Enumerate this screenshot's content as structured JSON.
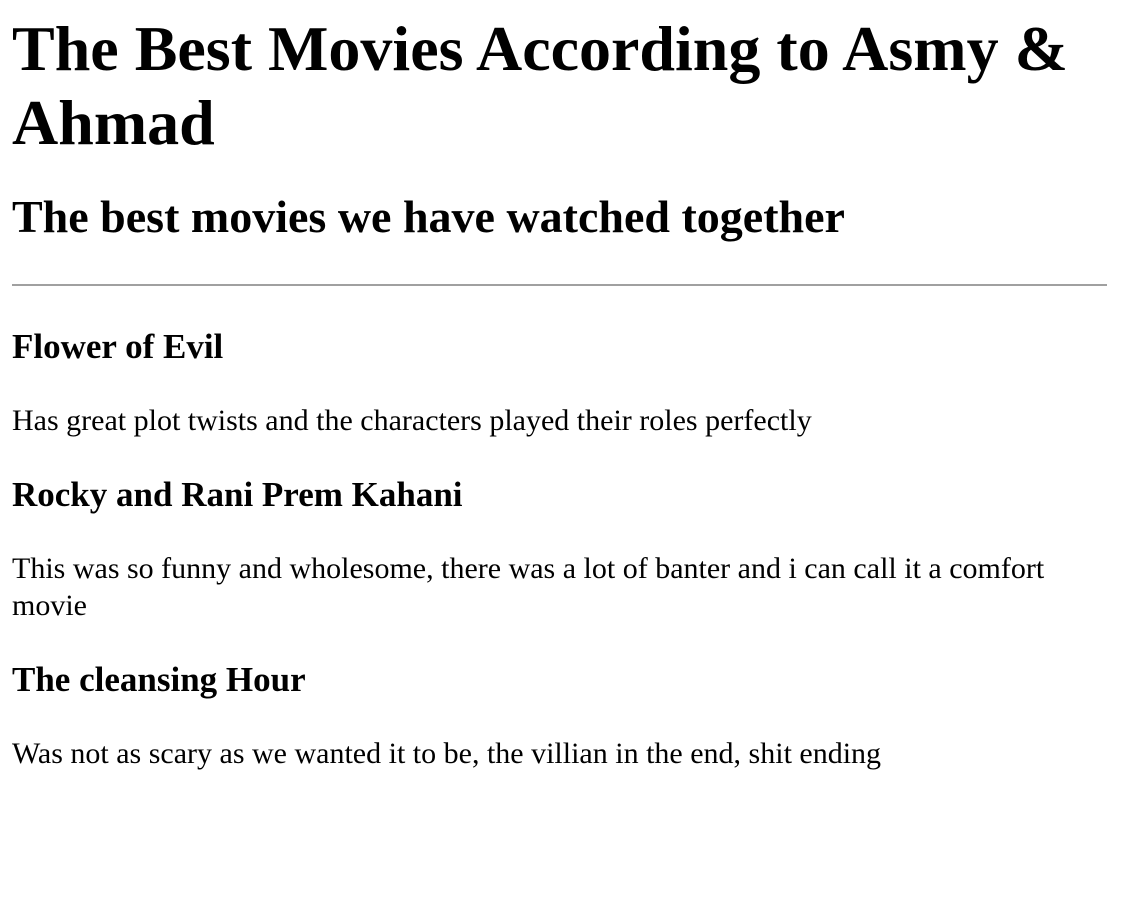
{
  "page": {
    "title": "The Best Movies According to Asmy & Ahmad",
    "subtitle": "The best movies we have watched together"
  },
  "movies": [
    {
      "title": "Flower of Evil",
      "description": "Has great plot twists and the characters played their roles perfectly"
    },
    {
      "title": "Rocky and Rani Prem Kahani",
      "description": "This was so funny and wholesome, there was a lot of banter and i can call it a comfort movie"
    },
    {
      "title": "The cleansing Hour",
      "description": "Was not as scary as we wanted it to be, the villian in the end, shit ending"
    }
  ]
}
